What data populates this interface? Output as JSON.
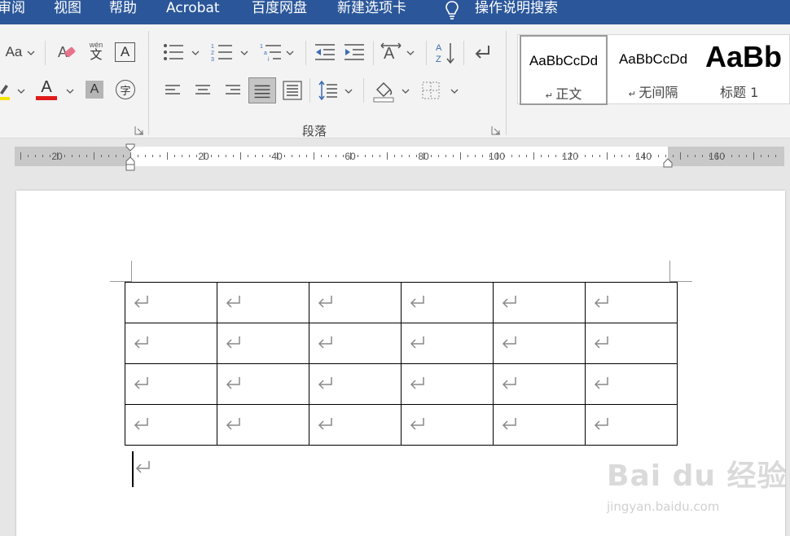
{
  "menu": {
    "items": [
      "审阅",
      "视图",
      "帮助",
      "Acrobat",
      "百度网盘",
      "新建选项卡",
      "操作说明搜索"
    ]
  },
  "ribbon": {
    "font_group": {
      "change_case_label": "Aa",
      "phonetic_top": "wén",
      "phonetic_bottom": "文",
      "char_border": "A",
      "font_color_letter": "A",
      "char_shading": "A",
      "enclose_char": "字",
      "highlight_color": "#f5e400",
      "font_color": "#e01b1b"
    },
    "paragraph_group": {
      "label": "段落"
    },
    "styles_group": {
      "items": [
        {
          "preview": "AaBbCcDd",
          "name": "正文",
          "selected": true
        },
        {
          "preview": "AaBbCcDd",
          "name": "无间隔",
          "selected": false
        },
        {
          "preview": "AaBb",
          "name": "标题 1",
          "selected": false
        }
      ]
    }
  },
  "ruler": {
    "labels": [
      "20",
      "20",
      "40",
      "60",
      "80",
      "100",
      "120",
      "140",
      "160"
    ]
  },
  "document": {
    "table": {
      "rows": 4,
      "cols": 6
    }
  },
  "watermark": {
    "brand": "Bai du 经验",
    "url": "jingyan.baidu.com"
  }
}
